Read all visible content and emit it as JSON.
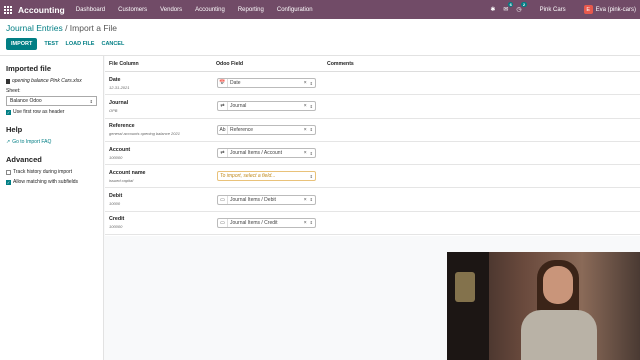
{
  "topbar": {
    "app_name": "Accounting",
    "menu": [
      "Dashboard",
      "Customers",
      "Vendors",
      "Accounting",
      "Reporting",
      "Configuration"
    ],
    "chat_count": "6",
    "activity_count": "2",
    "company": "Pink Cars",
    "user_initial": "E",
    "user_name": "Eva (pink-cars)"
  },
  "breadcrumb": {
    "parent": "Journal Entries",
    "separator": " / ",
    "current": "Import a File"
  },
  "buttons": {
    "import": "IMPORT",
    "test": "TEST",
    "load_file": "LOAD FILE",
    "cancel": "CANCEL"
  },
  "sidebar": {
    "imported_file_title": "Imported file",
    "file_name": "opening balance Pink Cars.xlsx",
    "sheet_label": "Sheet:",
    "sheet_value": "Balance Odoo",
    "first_row_header": "Use first row as header",
    "help_title": "Help",
    "faq_link": "Go to Import FAQ",
    "advanced_title": "Advanced",
    "track_history": "Track history during import",
    "allow_matching": "Allow matching with subfields"
  },
  "table": {
    "headers": [
      "File Column",
      "Odoo Field",
      "Comments"
    ],
    "rows": [
      {
        "column": "Date",
        "sample": "12-31-2021",
        "icon": "📅",
        "field": "Date",
        "placeholder": false
      },
      {
        "column": "Journal",
        "sample": "OPB",
        "icon": "⇄",
        "field": "Journal",
        "placeholder": false
      },
      {
        "column": "Reference",
        "sample": "general accounts opening balance 2021",
        "icon": "Ab",
        "field": "Reference",
        "placeholder": false
      },
      {
        "column": "Account",
        "sample": "100000",
        "icon": "⇄",
        "field": "Journal Items / Account",
        "placeholder": false
      },
      {
        "column": "Account name",
        "sample": "issued capital",
        "icon": "",
        "field": "To import, select a field...",
        "placeholder": true
      },
      {
        "column": "Debit",
        "sample": "10000",
        "icon": "▭",
        "field": "Journal Items / Debit",
        "placeholder": false
      },
      {
        "column": "Credit",
        "sample": "100000",
        "icon": "▭",
        "field": "Journal Items / Credit",
        "placeholder": false
      }
    ]
  },
  "colors": {
    "topbar": "#714b67",
    "accent": "#017e84"
  }
}
